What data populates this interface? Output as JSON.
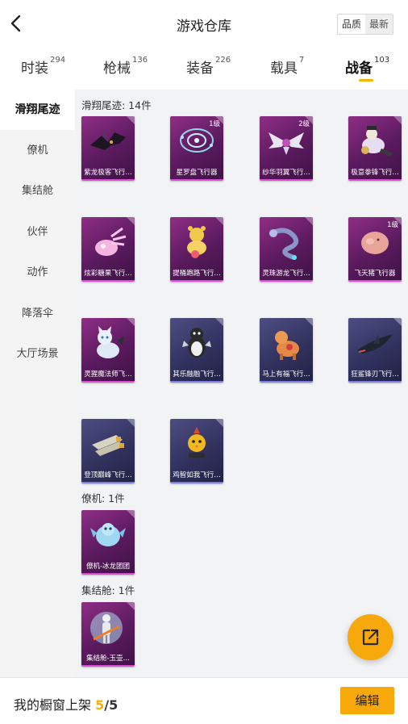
{
  "header": {
    "title": "游戏仓库",
    "sort": [
      "品质",
      "最新"
    ],
    "sort_active": "最新"
  },
  "tabs": [
    {
      "label": "时装",
      "count": "294"
    },
    {
      "label": "枪械",
      "count": "136"
    },
    {
      "label": "装备",
      "count": "226"
    },
    {
      "label": "载具",
      "count": "7"
    },
    {
      "label": "战备",
      "count": "103"
    }
  ],
  "sidebar": [
    "滑翔尾迹",
    "僚机",
    "集结舱",
    "伙伴",
    "动作",
    "降落伞",
    "大厅场景"
  ],
  "sections": [
    {
      "title": "滑翔尾迹: 14件",
      "items": [
        {
          "name": "紫龙极客飞行…",
          "rarity": "purple",
          "icon": "bat-dragon-icon"
        },
        {
          "name": "星罗盘飞行器",
          "rarity": "purple",
          "level": "1级",
          "icon": "star-compass-icon"
        },
        {
          "name": "纱华羽翼飞行…",
          "rarity": "purple",
          "level": "2级",
          "icon": "white-wings-icon"
        },
        {
          "name": "极意拳锋飞行…",
          "rarity": "purple",
          "icon": "fist-cloud-icon"
        },
        {
          "name": "炫彩糖果飞行…",
          "rarity": "purple",
          "icon": "candy-icon"
        },
        {
          "name": "提桶跑路飞行…",
          "rarity": "purple",
          "icon": "bucket-bear-icon"
        },
        {
          "name": "灵珠游龙飞行…",
          "rarity": "purple",
          "icon": "dragon-icon"
        },
        {
          "name": "飞天猪飞行器",
          "rarity": "purple",
          "level": "1级",
          "icon": "flying-pig-icon"
        },
        {
          "name": "灵猩魔法师飞…",
          "rarity": "purple",
          "icon": "magic-cat-icon"
        },
        {
          "name": "其乐融融飞行…",
          "rarity": "blue",
          "icon": "penguin-icon"
        },
        {
          "name": "马上有福飞行…",
          "rarity": "blue",
          "icon": "pony-icon"
        },
        {
          "name": "狂鲨锋刃飞行…",
          "rarity": "blue",
          "icon": "shark-jet-icon"
        },
        {
          "name": "登顶巅峰飞行…",
          "rarity": "blue",
          "icon": "jetpack-icon"
        },
        {
          "name": "鸡智如我飞行…",
          "rarity": "blue",
          "icon": "chick-icon"
        }
      ]
    },
    {
      "title": "僚机: 1件",
      "items": [
        {
          "name": "僚机-冰龙团团",
          "rarity": "purple",
          "icon": "ice-dragon-icon"
        }
      ]
    },
    {
      "title": "集结舱: 1件",
      "items": [
        {
          "name": "集结舱-玉壶…",
          "rarity": "purple",
          "icon": "pod-icon"
        }
      ]
    }
  ],
  "footer": {
    "shelf_label": "我的橱窗上架",
    "shelf_count": "5",
    "shelf_total": "5",
    "edit_label": "编辑"
  },
  "colors": {
    "accent": "#f7a90c",
    "purple_rarity": "#8f2e86",
    "blue_rarity": "#4d4d83"
  }
}
